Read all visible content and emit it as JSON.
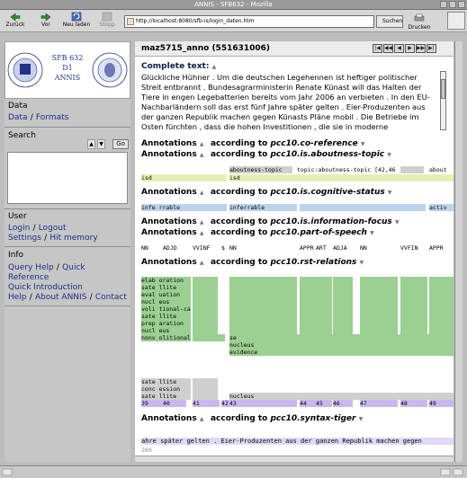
{
  "window": {
    "title": "ANNIS - SFB632 - Mozilla"
  },
  "toolbar": {
    "back": "Zurück",
    "forward": "Vor",
    "reload": "Neu laden",
    "stop": "Stopp",
    "url": "http://localhost:8080/sfb-is/login_daten.htm",
    "search": "Suchen",
    "print": "Drucken"
  },
  "sidebar": {
    "logo": {
      "text_top": "SFB 632",
      "text_mid": "D1",
      "text_bottom": "ANNIS",
      "seal_left": "Universität Potsdam",
      "seal_right": "Humboldt-Universität zu Berlin"
    },
    "data": {
      "title": "Data",
      "link1": "Data",
      "link2": "Formats"
    },
    "search": {
      "title": "Search",
      "go": "Go"
    },
    "user": {
      "title": "User",
      "login": "Login",
      "logout": "Logout",
      "settings": "Settings",
      "hit_memory": "Hit memory"
    },
    "info": {
      "title": "Info",
      "query_help": "Query Help",
      "quick": "Quick",
      "reference": "Reference",
      "quick_intro": "Quick Introduction",
      "help": "Help",
      "about": "About ANNIS",
      "contact": "Contact"
    }
  },
  "document": {
    "title": "maz5715_anno (551631006)",
    "complete_label": "Complete text:",
    "complete_text": "Glückliche Hühner . Um die deutschen Legehennen ist heftiger politischer Streit entbrannt . Bundesagrarministerin Renate Künast will das Halten der Tiere in engen Legebatterien bereits vom Jahr 2006 an verbieten . In den EU-Nachbarländern soll das erst fünf Jahre später gelten . Eier-Produzenten aus der ganzen Republik machen gegen Künasts Pläne mobil . Die Betriebe im Osten fürchten , dass die hohen Investitionen , die sie in moderne"
  },
  "annotations": [
    {
      "label": "Annotations",
      "according": "according to",
      "layer": "pcc10.co-reference"
    },
    {
      "label": "Annotations",
      "according": "according to",
      "layer": "pcc10.is.aboutness-topic"
    },
    {
      "label": "Annotations",
      "according": "according to",
      "layer": "pcc10.is.cognitive-status"
    },
    {
      "label": "Annotations",
      "according": "according to",
      "layer": "pcc10.is.information-focus"
    },
    {
      "label": "Annotations",
      "according": "according to",
      "layer": "pcc10.part-of-speech"
    },
    {
      "label": "Annotations",
      "according": "according to",
      "layer": "pcc10.rst-relations"
    },
    {
      "label": "Annotations",
      "according": "according to",
      "layer": "pcc10.syntax-tiger"
    }
  ],
  "aboutness": {
    "c1": "aboutness-topic",
    "c2": "topic:aboutness-topic [42,46]",
    "c3": "about",
    "c4": "isd",
    "c5": "isd"
  },
  "cognitive": {
    "c1": "infe rrable",
    "c2": "inferrable",
    "c3": "activ"
  },
  "pos": [
    "NN",
    "ADJD",
    "VVINF",
    "$",
    "NN",
    "APPR",
    "ART",
    "ADJA",
    "NN",
    "VVFIN",
    "APPR"
  ],
  "rst": {
    "rows": [
      "elab oration",
      "sate llite",
      "eval uation",
      "nucl eus",
      "voli tional-cause",
      "sate llite",
      "prep aration",
      "nucl eus",
      "nonv olitional-cause"
    ],
    "sub": [
      "se",
      "nucleus",
      "evidence"
    ],
    "bottom": [
      "sate llite",
      "conc ession",
      "sate llite"
    ],
    "bottom_nucleus": "nucleus",
    "numbers": [
      "39",
      "40",
      "41",
      "42",
      "43",
      "44",
      "45",
      "46",
      "47",
      "48",
      "49"
    ]
  },
  "syntax_text": "ahre später gelten . Eier-Produzenten aus der ganzen Republik machen gegen",
  "syntax_number": "260"
}
